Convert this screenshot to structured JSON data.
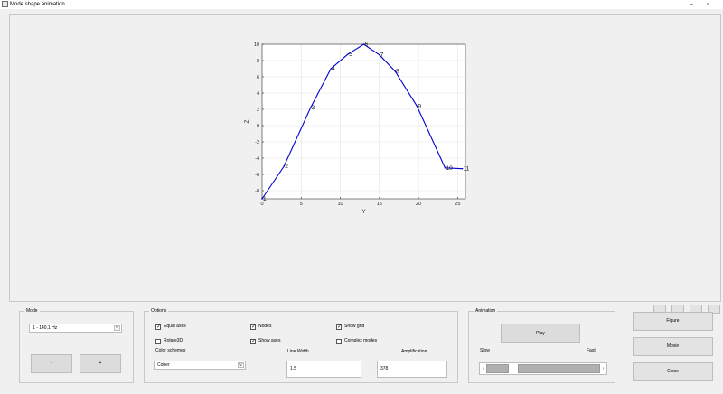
{
  "window": {
    "title": "Mode shape animation",
    "minimize": "–",
    "restore": "▫"
  },
  "chart_data": {
    "type": "line",
    "title": "",
    "xlabel": "Y",
    "ylabel": "Z",
    "xlim": [
      0,
      26
    ],
    "ylim": [
      -9,
      10
    ],
    "grid": true,
    "x_ticks": [
      0,
      5,
      10,
      15,
      20,
      25
    ],
    "y_ticks": [
      -8,
      -6,
      -4,
      -2,
      0,
      2,
      4,
      6,
      8,
      10
    ],
    "series": [
      {
        "color": "#0000d0",
        "x": [
          0,
          2.8,
          6.2,
          8.8,
          11,
          13,
          15,
          17,
          19.8,
          23.4,
          25.6
        ],
        "y": [
          -9,
          -5,
          2.2,
          7,
          8.8,
          10,
          8.7,
          6.7,
          2.4,
          -5.2,
          -5.3
        ],
        "labels": [
          "1",
          "2",
          "3",
          "4",
          "5",
          "6",
          "7",
          "8",
          "9",
          "10",
          "11"
        ]
      }
    ]
  },
  "mode_panel": {
    "title": "Mode",
    "selected": "1 - 140.1 Hz",
    "prev_label": "-",
    "next_label": "+"
  },
  "options_panel": {
    "title": "Options",
    "equal_axes": "Equal axes",
    "nodes": "Nodes",
    "show_grid": "Show grid",
    "rotate3d": "Rotate3D",
    "show_axes": "Show axes",
    "complex_modes": "Complex modes",
    "color_schemes_label": "Color schemes",
    "color_scheme_value": "Cober",
    "line_width_label": "Line Width",
    "line_width_value": "1.5",
    "amplification_label": "Amplification",
    "amplification_value": "378",
    "check": "✓"
  },
  "animation_panel": {
    "title": "Animation",
    "play_label": "Play",
    "slow_label": "Slow",
    "fast_label": "Fast",
    "left_arrow": "‹",
    "right_arrow": "›"
  },
  "side_buttons": {
    "figure": "Figure",
    "movie": "Movie",
    "close": "Close"
  }
}
